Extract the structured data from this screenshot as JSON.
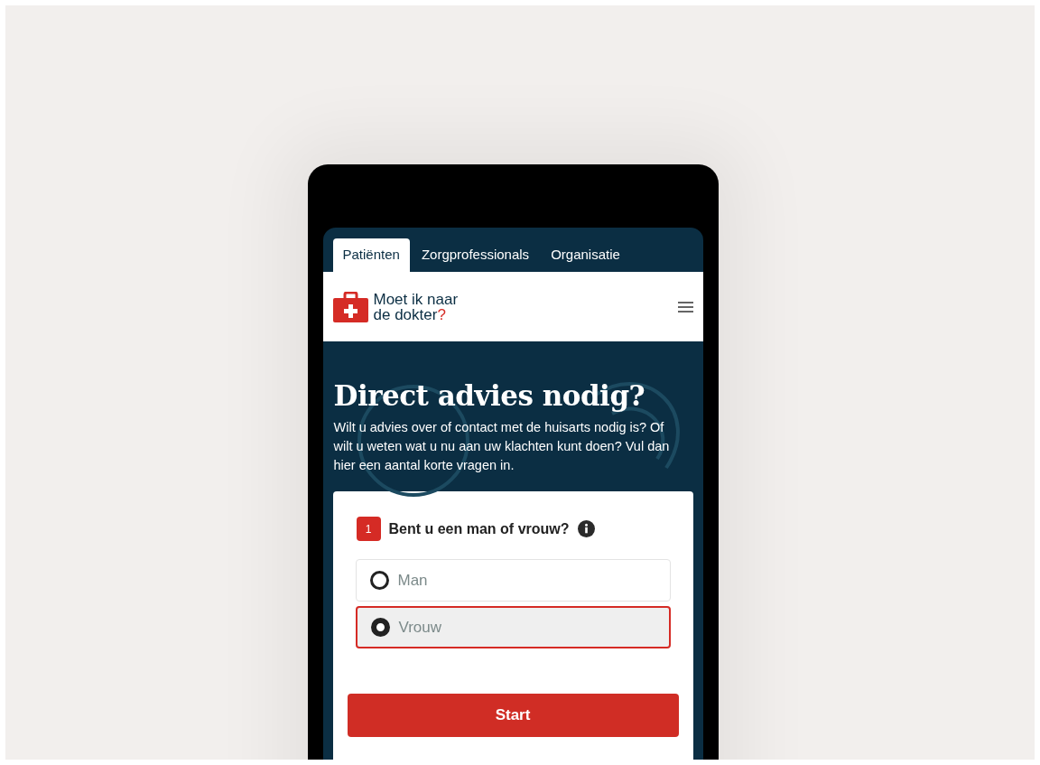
{
  "tabs": [
    {
      "label": "Patiënten",
      "selected": true
    },
    {
      "label": "Zorgprofessionals",
      "selected": false
    },
    {
      "label": "Organisatie",
      "selected": false
    }
  ],
  "logo": {
    "line_1": "Moet ik naar",
    "line_2": "de dokter",
    "mark": "?"
  },
  "hero": {
    "title": "Direct advies nodig?",
    "text": "Wilt u advies over of contact met de huisarts nodig is? Of wilt u weten wat u nu aan uw klachten kunt doen? Vul dan hier een aantal korte vragen in."
  },
  "question": {
    "number": "1",
    "label": "Bent u een man of vrouw?",
    "options": [
      {
        "label": "Man",
        "selected": false
      },
      {
        "label": "Vrouw",
        "selected": true
      }
    ]
  },
  "start_button": "Start"
}
